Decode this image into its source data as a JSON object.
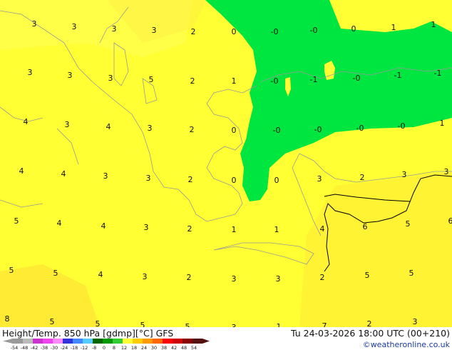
{
  "map": {
    "colors": {
      "yellow": "#ffff33",
      "light_yellow": "#ffff66",
      "pale_orange": "#ffe033",
      "green": "#00e640",
      "coast": "#999999",
      "border": "#000000"
    },
    "contour_values": [
      {
        "v": "3"
      },
      {
        "v": "3"
      },
      {
        "v": "3"
      },
      {
        "v": "3"
      },
      {
        "v": "2"
      },
      {
        "v": "0"
      },
      {
        "v": "-0"
      },
      {
        "v": "-0"
      },
      {
        "v": "0"
      },
      {
        "v": "1"
      },
      {
        "v": "1"
      },
      {
        "v": "3"
      },
      {
        "v": "3"
      },
      {
        "v": "3"
      },
      {
        "v": "5"
      },
      {
        "v": "2"
      },
      {
        "v": "1"
      },
      {
        "v": "-0"
      },
      {
        "v": "-1"
      },
      {
        "v": "-0"
      },
      {
        "v": "-1"
      },
      {
        "v": "-1"
      },
      {
        "v": "4"
      },
      {
        "v": "3"
      },
      {
        "v": "4"
      },
      {
        "v": "3"
      },
      {
        "v": "2"
      },
      {
        "v": "0"
      },
      {
        "v": "-0"
      },
      {
        "v": "-0"
      },
      {
        "v": "-0"
      },
      {
        "v": "-0"
      },
      {
        "v": "1"
      },
      {
        "v": "4"
      },
      {
        "v": "4"
      },
      {
        "v": "3"
      },
      {
        "v": "3"
      },
      {
        "v": "2"
      },
      {
        "v": "0"
      },
      {
        "v": "0"
      },
      {
        "v": "3"
      },
      {
        "v": "2"
      },
      {
        "v": "3"
      },
      {
        "v": "3"
      },
      {
        "v": "5"
      },
      {
        "v": "4"
      },
      {
        "v": "4"
      },
      {
        "v": "3"
      },
      {
        "v": "2"
      },
      {
        "v": "1"
      },
      {
        "v": "1"
      },
      {
        "v": "4"
      },
      {
        "v": "6"
      },
      {
        "v": "5"
      },
      {
        "v": "6"
      },
      {
        "v": "5"
      },
      {
        "v": "5"
      },
      {
        "v": "4"
      },
      {
        "v": "3"
      },
      {
        "v": "2"
      },
      {
        "v": "3"
      },
      {
        "v": "3"
      },
      {
        "v": "2"
      },
      {
        "v": "5"
      },
      {
        "v": "5"
      },
      {
        "v": "8"
      },
      {
        "v": "5"
      },
      {
        "v": "5"
      },
      {
        "v": "5"
      },
      {
        "v": "5"
      },
      {
        "v": "3"
      },
      {
        "v": "1"
      },
      {
        "v": "7"
      },
      {
        "v": "2"
      },
      {
        "v": "3"
      }
    ]
  },
  "footer": {
    "title": "Height/Temp. 850 hPa [gdmp][°C] GFS",
    "datetime": "Tu 24-03-2026 18:00 UTC (00+210)",
    "copyright": "©weatheronline.co.uk"
  },
  "legend": {
    "ticks": [
      "-54",
      "-48",
      "-42",
      "-38",
      "-30",
      "-24",
      "-18",
      "-12",
      "-8",
      "0",
      "8",
      "12",
      "18",
      "24",
      "30",
      "38",
      "42",
      "48",
      "54"
    ],
    "colors": [
      "#9a9a9a",
      "#bbbbbb",
      "#cc33cc",
      "#ee44ee",
      "#ff88ff",
      "#3333dd",
      "#4488ff",
      "#55ccff",
      "#006600",
      "#009900",
      "#33cc33",
      "#ffff33",
      "#ffcc00",
      "#ff9900",
      "#ff6600",
      "#ff0000",
      "#cc0000",
      "#880000",
      "#551111"
    ]
  }
}
